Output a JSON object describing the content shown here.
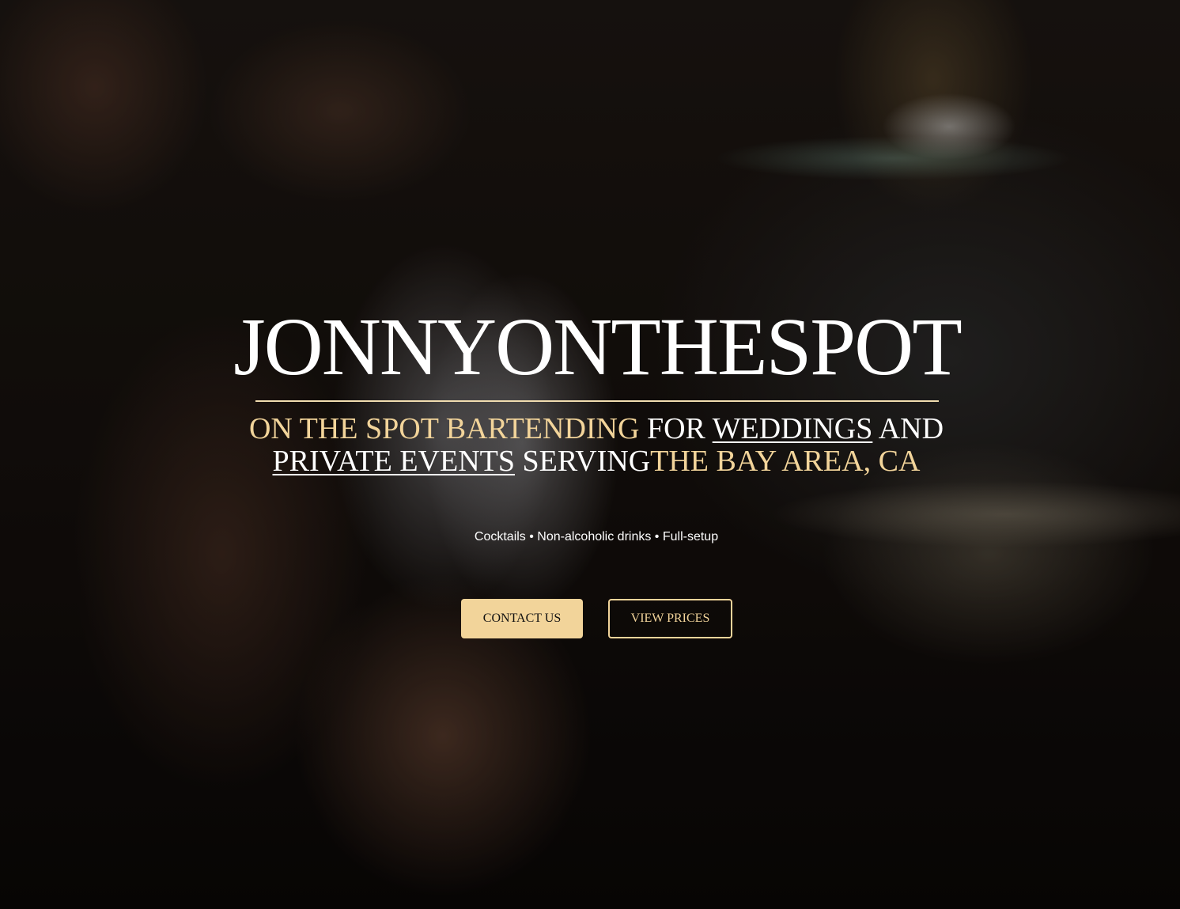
{
  "hero": {
    "brand": "JONNYONTHESPOT",
    "tagline": {
      "part1": "ON THE SPOT BARTENDING",
      "part2": " FOR ",
      "part3": "WEDDINGS",
      "part4": " AND",
      "part5": "PRIVATE EVENTS",
      "part6": " SERVING",
      "part7": "THE BAY AREA, CA"
    },
    "services": "Cocktails • Non-alcoholic drinks • Full-setup",
    "buttons": {
      "contact_label": "CONTACT US",
      "prices_label": "VIEW PRICES"
    }
  },
  "colors": {
    "accent_gold": "#f2d49a",
    "text_white": "#ffffff"
  }
}
